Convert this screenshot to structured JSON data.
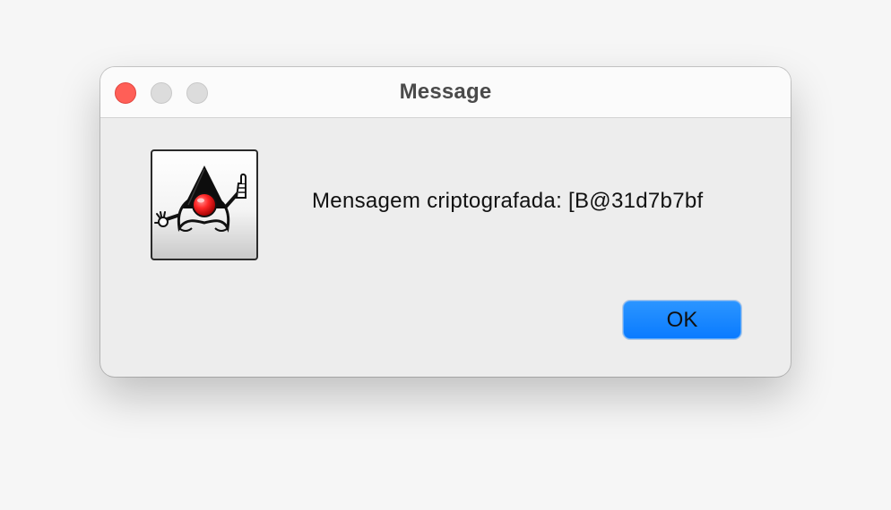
{
  "window": {
    "title": "Message"
  },
  "title_bar": {
    "buttons": [
      "close",
      "minimize",
      "zoom"
    ]
  },
  "dialog": {
    "icon": "java-duke-icon",
    "message": "Mensagem criptografada: [B@31d7b7bf",
    "ok_label": "OK"
  },
  "colors": {
    "close_button": "#ff5f57",
    "inactive_button": "#dcdcdc",
    "ok_button": "#0a7bff",
    "window_background": "#ededed",
    "titlebar_background": "#fbfbfb"
  }
}
